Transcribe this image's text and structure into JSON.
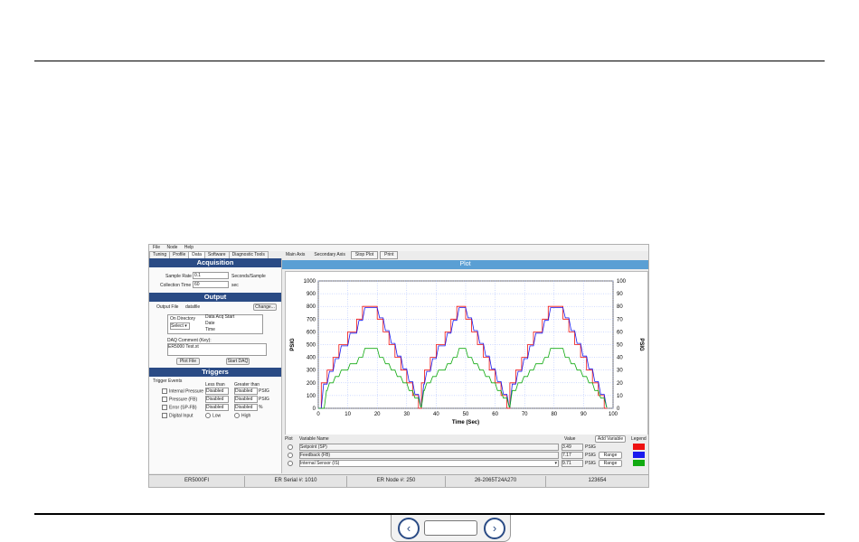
{
  "app": {
    "menu": [
      "File",
      "Node",
      "Help"
    ],
    "left_tabs": [
      "Tuning",
      "Profile",
      "Data",
      "Software",
      "Diagnostic Tools"
    ],
    "acquisition": {
      "header": "Acquisition",
      "sample_rate_label": "Sample Rate",
      "sample_rate_value": "0.1",
      "sample_rate_unit": "Seconds/Sample",
      "collection_time_label": "Collection Time",
      "collection_time_value": "60",
      "collection_time_unit": "sec"
    },
    "output": {
      "header": "Output",
      "output_file_label": "Output File",
      "output_file_value": "datafile",
      "change_button": "Change...",
      "on_directory_label": "On Directory",
      "select_value": "Select",
      "fields": [
        "Data Acq Start",
        "Date",
        "Time"
      ],
      "comment_label": "DAQ Comment (Key):",
      "comment_value": "ER5000 Test.xt",
      "plot_file_button": "Plot File",
      "start_daq_button": "Start DAQ"
    },
    "triggers": {
      "header": "Triggers",
      "trigger_events_label": "Trigger Events",
      "col_less_than": "Less than",
      "col_greater_than": "Greater than",
      "rows": [
        {
          "name": "Internal Pressure",
          "less": "Disabled",
          "greater": "Disabled",
          "unit": "PSIG"
        },
        {
          "name": "Pressure (FB)",
          "less": "Disabled",
          "greater": "Disabled",
          "unit": "PSIG"
        },
        {
          "name": "Error (SP-FB)",
          "less": "Disabled",
          "greater": "Disabled",
          "unit": "%"
        },
        {
          "name": "Digital Input",
          "less": "Low",
          "greater": "High",
          "unit": ""
        }
      ]
    },
    "right_tabs": [
      "Main Axis",
      "Secondary Axis",
      "Stop Plot",
      "Print"
    ],
    "plot_header": "Plot",
    "variables": {
      "col_plot": "Plot",
      "col_name": "Variable Name",
      "col_value": "Value",
      "add_variable_button": "Add Variable",
      "col_legend": "Legend",
      "rows": [
        {
          "name": "Setpoint (SP)",
          "value": "3.49",
          "unit": "PSIG",
          "range": "",
          "color": "#ee1111"
        },
        {
          "name": "Feedback (FB)",
          "value": "7.17",
          "unit": "PSIG",
          "range": "Range",
          "color": "#1a1aee"
        },
        {
          "name": "Internal Sensor (IS)",
          "value": "9.71",
          "unit": "PSIG",
          "range": "Range",
          "color": "#11aa11"
        }
      ]
    },
    "status": [
      "ER5000FI",
      "ER Serial #: 1010",
      "ER Node #: 250",
      "26-2065T24A270",
      "123654"
    ]
  },
  "chart_data": {
    "type": "line",
    "xlabel": "Time (Sec)",
    "ylabel": "PSIG",
    "ylabel_right": "PSIG",
    "xlim": [
      0,
      100
    ],
    "ylim": [
      0,
      1000
    ],
    "ylim_right": [
      0,
      100
    ],
    "xticks": [
      0,
      10,
      20,
      30,
      40,
      50,
      60,
      70,
      80,
      90,
      100
    ],
    "yticks": [
      0,
      100,
      200,
      300,
      400,
      500,
      600,
      700,
      800,
      900,
      1000
    ],
    "yticks_right": [
      0,
      10,
      20,
      30,
      40,
      50,
      60,
      70,
      80,
      90,
      100
    ],
    "grid": true,
    "series": [
      {
        "name": "Setpoint (SP)",
        "color": "#ee1111",
        "x": [
          0,
          1,
          1,
          3,
          3,
          5,
          5,
          7,
          7,
          10,
          10,
          13,
          13,
          15,
          15,
          17,
          17,
          20,
          20,
          22,
          22,
          24,
          24,
          26,
          26,
          28,
          28,
          30,
          30,
          32,
          32,
          34,
          34,
          35,
          35,
          36,
          36,
          38,
          38,
          40,
          40,
          43,
          43,
          45,
          45,
          47,
          47,
          50,
          50,
          52,
          52,
          54,
          54,
          56,
          56,
          58,
          58,
          60,
          60,
          62,
          62,
          64,
          64,
          65,
          65,
          67,
          67,
          69,
          69,
          71,
          71,
          73,
          73,
          76,
          76,
          78,
          78,
          80,
          80,
          83,
          83,
          85,
          85,
          87,
          87,
          89,
          89,
          91,
          91,
          93,
          93,
          95,
          95,
          97,
          97,
          98
        ],
        "y": [
          0,
          0,
          200,
          200,
          300,
          300,
          400,
          400,
          500,
          500,
          600,
          600,
          700,
          700,
          800,
          800,
          800,
          800,
          700,
          700,
          600,
          600,
          500,
          500,
          400,
          400,
          300,
          300,
          200,
          200,
          100,
          100,
          0,
          0,
          200,
          200,
          300,
          300,
          400,
          400,
          500,
          500,
          600,
          600,
          700,
          700,
          800,
          800,
          700,
          700,
          600,
          600,
          500,
          500,
          400,
          400,
          300,
          300,
          200,
          200,
          100,
          100,
          0,
          0,
          200,
          200,
          300,
          300,
          400,
          400,
          500,
          500,
          600,
          600,
          700,
          700,
          800,
          800,
          800,
          800,
          700,
          700,
          600,
          600,
          500,
          500,
          400,
          400,
          300,
          300,
          200,
          200,
          100,
          100,
          0,
          0
        ]
      },
      {
        "name": "Feedback (FB)",
        "color": "#1a1aee",
        "x": [
          0,
          1,
          1.8,
          3,
          3.8,
          5,
          5.8,
          7,
          7.8,
          10,
          10.8,
          13,
          13.8,
          15,
          15.8,
          20,
          20.8,
          22,
          22.8,
          24,
          24.8,
          26,
          26.8,
          28,
          28.8,
          30,
          30.8,
          32,
          32.8,
          34,
          34.8,
          35,
          35.8,
          36,
          36.8,
          38,
          38.8,
          40,
          40.8,
          43,
          43.8,
          45,
          45.8,
          47,
          47.8,
          50,
          50.8,
          52,
          52.8,
          54,
          54.8,
          56,
          56.8,
          58,
          58.8,
          60,
          60.8,
          62,
          62.8,
          64,
          64.8,
          65,
          65.8,
          67,
          67.8,
          69,
          69.8,
          71,
          71.8,
          73,
          73.8,
          76,
          76.8,
          78,
          78.8,
          83,
          83.8,
          85,
          85.8,
          87,
          87.8,
          89,
          89.8,
          91,
          91.8,
          93,
          93.8,
          95,
          95.8,
          97,
          97.8,
          98
        ],
        "y": [
          0,
          0,
          190,
          190,
          290,
          290,
          390,
          390,
          490,
          490,
          590,
          590,
          690,
          690,
          790,
          790,
          710,
          710,
          610,
          610,
          510,
          510,
          410,
          410,
          310,
          310,
          210,
          210,
          110,
          110,
          10,
          10,
          190,
          190,
          290,
          290,
          390,
          390,
          490,
          490,
          590,
          590,
          690,
          690,
          790,
          790,
          710,
          710,
          610,
          610,
          510,
          510,
          410,
          410,
          310,
          310,
          210,
          210,
          110,
          110,
          10,
          10,
          190,
          190,
          290,
          290,
          390,
          390,
          490,
          490,
          590,
          590,
          690,
          690,
          790,
          790,
          710,
          710,
          610,
          610,
          510,
          510,
          410,
          410,
          310,
          310,
          210,
          210,
          110,
          110,
          10,
          10
        ]
      },
      {
        "name": "Internal Sensor (IS)",
        "color": "#11aa11",
        "x": [
          0,
          2,
          2.8,
          3,
          3.8,
          5,
          5.8,
          7,
          7.8,
          10,
          10.8,
          13,
          13.8,
          15,
          15.8,
          20,
          20.8,
          22,
          22.8,
          24,
          24.8,
          26,
          26.8,
          28,
          28.8,
          30,
          30.8,
          32,
          32.8,
          34,
          34.8,
          35,
          35.8,
          36,
          36.8,
          38,
          38.8,
          40,
          40.8,
          43,
          43.8,
          45,
          45.8,
          47,
          47.8,
          50,
          50.8,
          52,
          52.8,
          54,
          54.8,
          56,
          56.8,
          58,
          58.8,
          60,
          60.8,
          62,
          62.8,
          64,
          64.8,
          65,
          65.8,
          67,
          67.8,
          69,
          69.8,
          71,
          71.8,
          73,
          73.8,
          76,
          76.8,
          78,
          78.8,
          83,
          83.8,
          85,
          85.8,
          87,
          87.8,
          89,
          89.8,
          91,
          91.8,
          93,
          93.8,
          95,
          95.8,
          97,
          97.8,
          98
        ],
        "y": [
          0,
          0,
          140,
          140,
          200,
          200,
          250,
          250,
          300,
          300,
          350,
          350,
          400,
          400,
          470,
          470,
          400,
          400,
          350,
          350,
          300,
          300,
          250,
          250,
          200,
          200,
          140,
          140,
          80,
          80,
          10,
          10,
          140,
          140,
          200,
          200,
          250,
          250,
          300,
          300,
          350,
          350,
          400,
          400,
          470,
          470,
          400,
          400,
          350,
          350,
          300,
          300,
          250,
          250,
          200,
          200,
          140,
          140,
          80,
          80,
          10,
          10,
          140,
          140,
          200,
          200,
          250,
          250,
          300,
          300,
          350,
          350,
          400,
          400,
          470,
          470,
          400,
          400,
          350,
          350,
          300,
          300,
          250,
          250,
          200,
          200,
          140,
          140,
          80,
          80,
          10,
          10
        ]
      }
    ]
  }
}
